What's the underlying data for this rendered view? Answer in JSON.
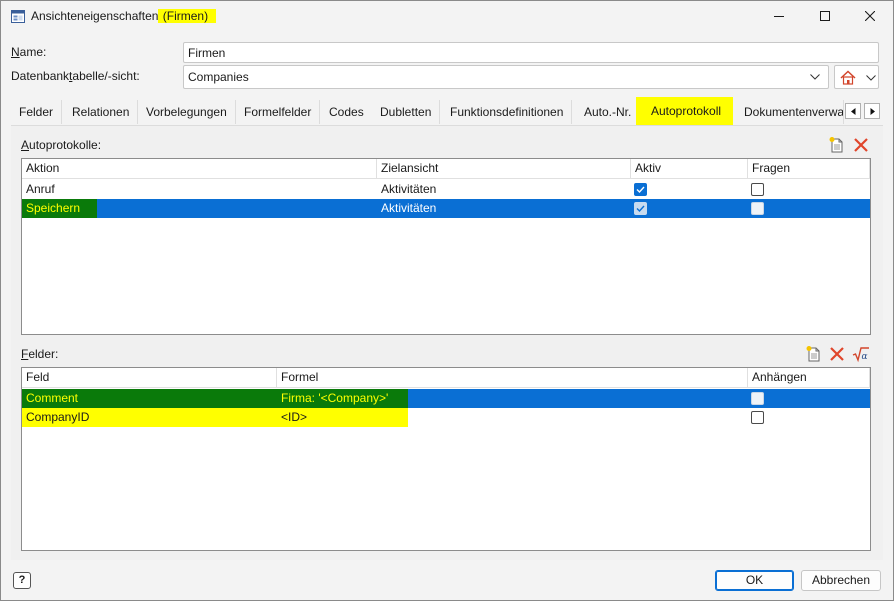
{
  "window": {
    "title_prefix": "Ansichteneigenschaften",
    "title_highlight": " (Firmen)"
  },
  "form": {
    "name_label": "Name:",
    "name_value": "Firmen",
    "table_label": "Datenbanktabelle/-sicht:",
    "table_value": "Companies"
  },
  "tabs": [
    "Felder",
    "Relationen",
    "Vorbelegungen",
    "Formelfelder",
    "Codes",
    "Dubletten",
    "Funktionsdefinitionen",
    "Auto.-Nr.",
    "Autoprotokoll",
    "Dokumentenverwa"
  ],
  "autoprotokolle": {
    "label": "Autoprotokolle:",
    "columns": [
      "Aktion",
      "Zielansicht",
      "Aktiv",
      "Fragen"
    ],
    "rows": [
      {
        "aktion": "Anruf",
        "zielansicht": "Aktivitäten",
        "aktiv": true,
        "fragen": false
      },
      {
        "aktion": "Speichern",
        "zielansicht": "Aktivitäten",
        "aktiv": true,
        "fragen": false
      }
    ]
  },
  "felder": {
    "label": "Felder:",
    "columns": [
      "Feld",
      "Formel",
      "Anhängen"
    ],
    "rows": [
      {
        "feld": "Comment",
        "formel": "Firma: '<Company>'",
        "anhaengen": false
      },
      {
        "feld": "CompanyID",
        "formel": "<ID>",
        "anhaengen": false
      }
    ]
  },
  "footer": {
    "help": "?",
    "ok": "OK",
    "cancel": "Abbrechen"
  },
  "colors": {
    "selection": "#0a6fd4",
    "highlight_yellow": "#ffff00",
    "highlight_green": "#0a7a0a",
    "delete_red": "#e0452b"
  }
}
